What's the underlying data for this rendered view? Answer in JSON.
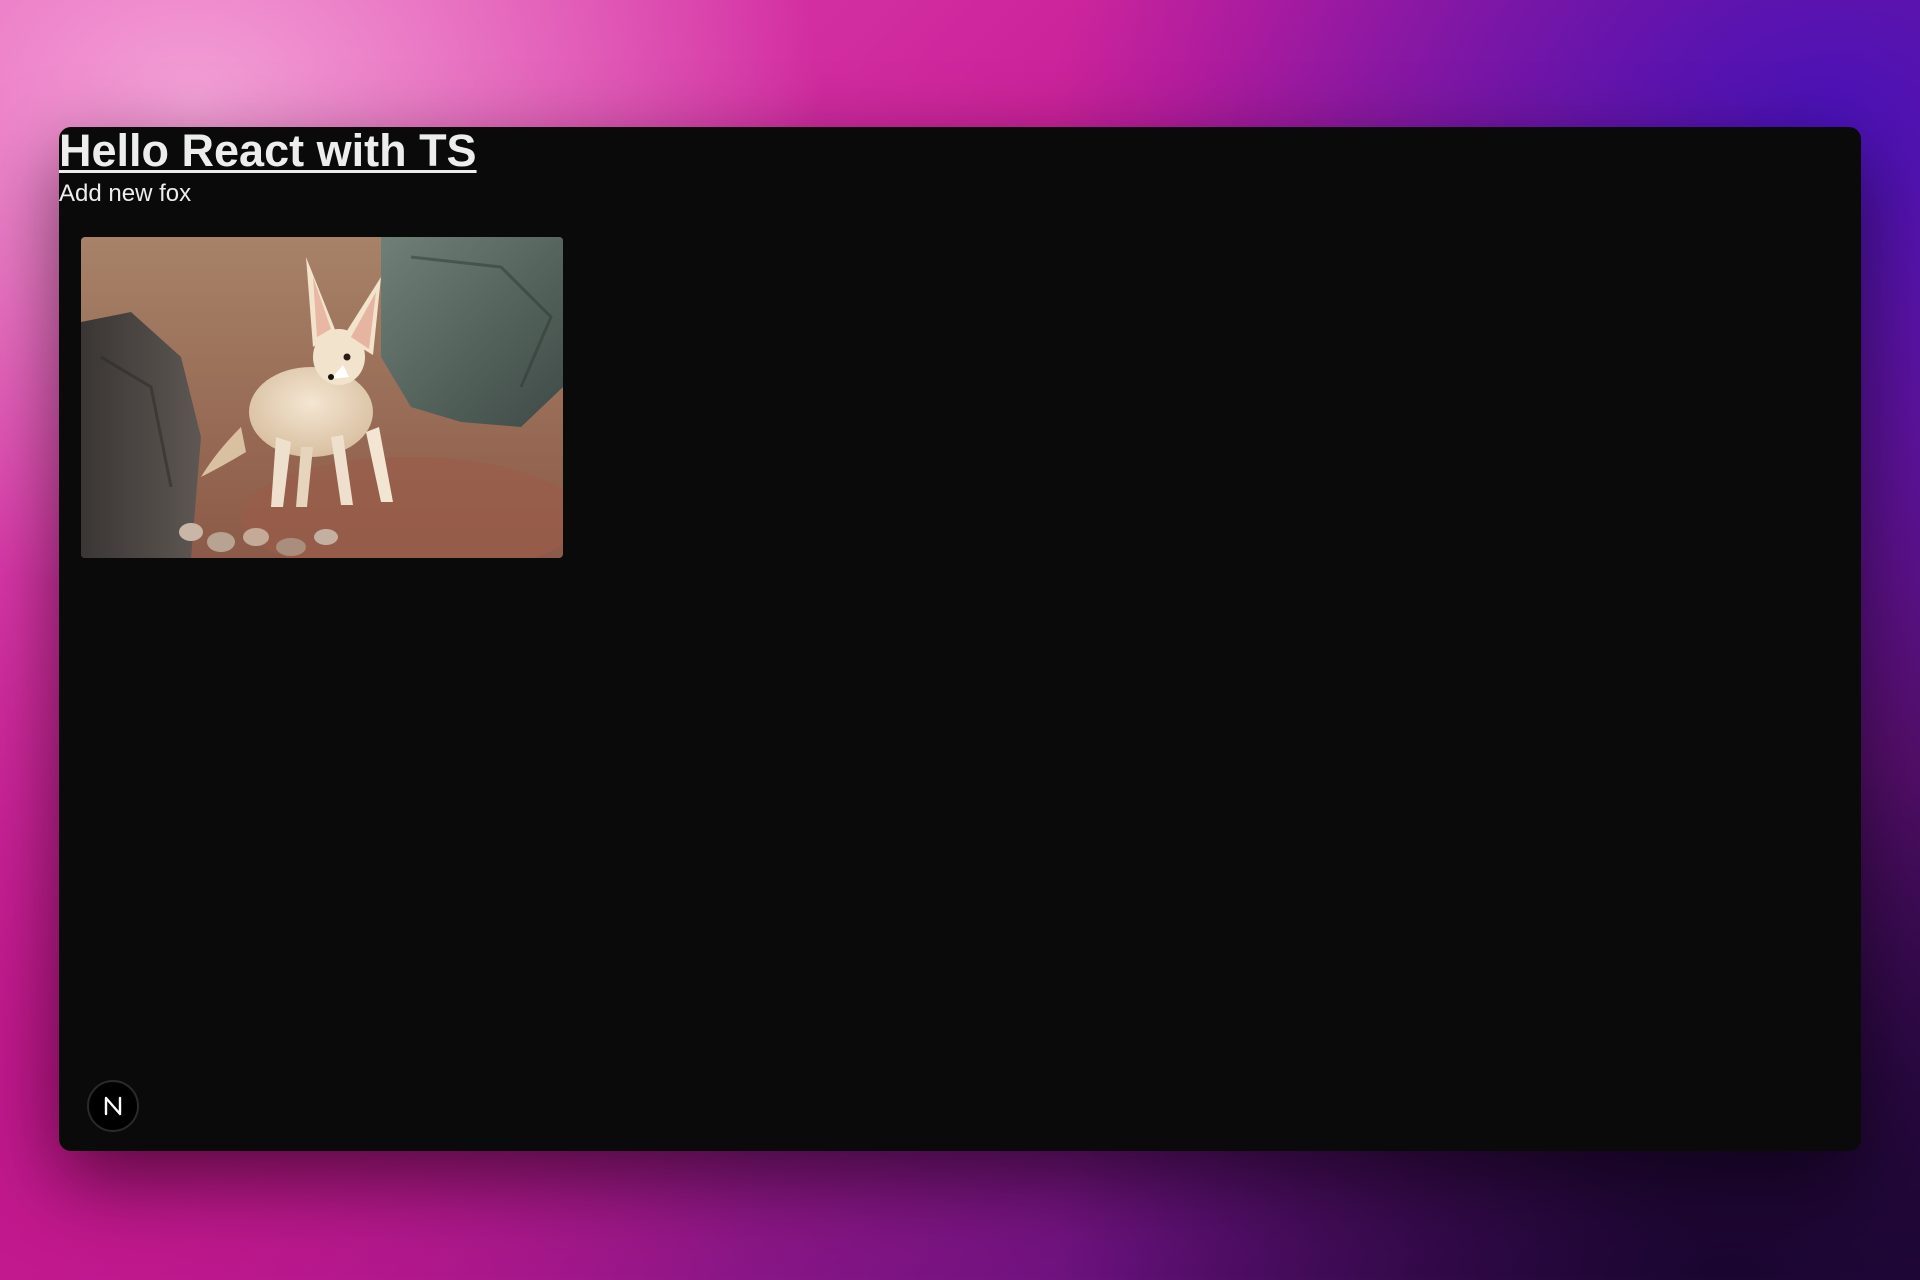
{
  "page": {
    "title": "Hello React with TS",
    "add_button_label": "Add new fox"
  },
  "images": [
    {
      "subject": "fennec fox standing on rocky ground between stones"
    }
  ],
  "dev_indicator": {
    "icon": "nextjs-logo-icon",
    "label": "N"
  },
  "colors": {
    "window_background": "#0a0a0a",
    "text": "#ededed",
    "backdrop_pink": "#e54bb4",
    "backdrop_purple": "#4a12b8"
  }
}
